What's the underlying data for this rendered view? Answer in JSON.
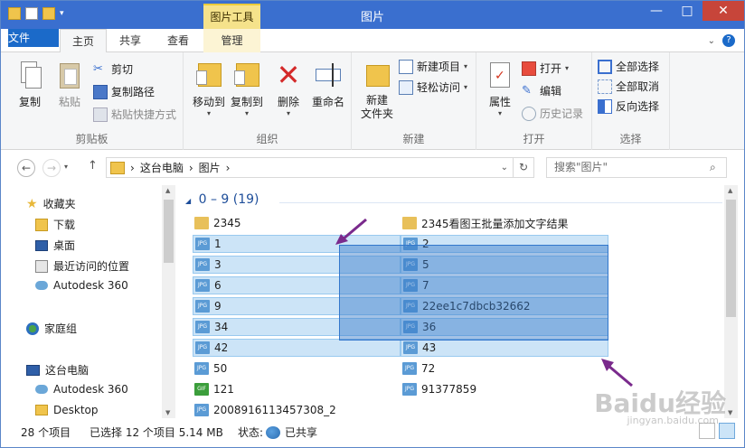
{
  "window": {
    "title": "图片",
    "context_tab": "图片工具"
  },
  "ribbon_tabs": {
    "file": "文件",
    "home": "主页",
    "share": "共享",
    "view": "查看",
    "manage": "管理"
  },
  "clipboard": {
    "label": "剪贴板",
    "copy": "复制",
    "paste": "粘贴",
    "cut": "剪切",
    "copy_path": "复制路径",
    "paste_shortcut": "粘贴快捷方式"
  },
  "organize": {
    "label": "组织",
    "move_to": "移动到",
    "copy_to": "复制到",
    "delete": "删除",
    "rename": "重命名"
  },
  "new": {
    "label": "新建",
    "new_folder": "新建\n文件夹",
    "new_item": "新建项目",
    "easy_access": "轻松访问"
  },
  "open": {
    "label": "打开",
    "properties": "属性",
    "open": "打开",
    "edit": "编辑",
    "history": "历史记录"
  },
  "select": {
    "label": "选择",
    "select_all": "全部选择",
    "select_none": "全部取消",
    "invert": "反向选择"
  },
  "address": {
    "this_pc": "这台电脑",
    "folder": "图片",
    "sep": "›"
  },
  "search": {
    "placeholder": "搜索\"图片\""
  },
  "nav": {
    "favorites": "收藏夹",
    "downloads": "下载",
    "desktop": "桌面",
    "recent": "最近访问的位置",
    "autodesk": "Autodesk 360",
    "homegroup": "家庭组",
    "this_pc": "这台电脑",
    "pc_autodesk": "Autodesk 360",
    "pc_desktop": "Desktop"
  },
  "group_header": "0 – 9 (19)",
  "files": [
    {
      "name": "2345",
      "kind": "folder",
      "selected": false
    },
    {
      "name": "2345看图王批量添加文字结果",
      "kind": "folder",
      "selected": false
    },
    {
      "name": "1",
      "kind": "jpg",
      "selected": true
    },
    {
      "name": "2",
      "kind": "jpg",
      "selected": true
    },
    {
      "name": "3",
      "kind": "jpg",
      "selected": true
    },
    {
      "name": "5",
      "kind": "jpg",
      "selected": true
    },
    {
      "name": "6",
      "kind": "jpg",
      "selected": true
    },
    {
      "name": "7",
      "kind": "jpg",
      "selected": true
    },
    {
      "name": "9",
      "kind": "jpg",
      "selected": true
    },
    {
      "name": "22ee1c7dbcb32662",
      "kind": "jpg",
      "selected": true
    },
    {
      "name": "34",
      "kind": "jpg",
      "selected": true
    },
    {
      "name": "36",
      "kind": "jpg",
      "selected": true
    },
    {
      "name": "42",
      "kind": "jpg",
      "selected": true
    },
    {
      "name": "43",
      "kind": "jpg",
      "selected": true
    },
    {
      "name": "50",
      "kind": "jpg",
      "selected": false
    },
    {
      "name": "72",
      "kind": "jpg",
      "selected": false
    },
    {
      "name": "121",
      "kind": "gif",
      "selected": false
    },
    {
      "name": "91377859",
      "kind": "jpg",
      "selected": false
    },
    {
      "name": "2008916113457308_2",
      "kind": "jpg",
      "selected": false
    }
  ],
  "status": {
    "count": "28 个项目",
    "selected": "已选择 12 个项目 5.14 MB",
    "state_label": "状态:",
    "state_value": "已共享"
  },
  "watermark": {
    "brand": "Baidu经验",
    "url": "jingyan.baidu.com"
  },
  "icon_labels": {
    "jpg": "JPG",
    "gif": "GIF"
  },
  "colors": {
    "accent": "#1b6ac9",
    "selection": "#cce4f7",
    "drag": "#3377cc",
    "arrow": "#7a2a8c"
  }
}
